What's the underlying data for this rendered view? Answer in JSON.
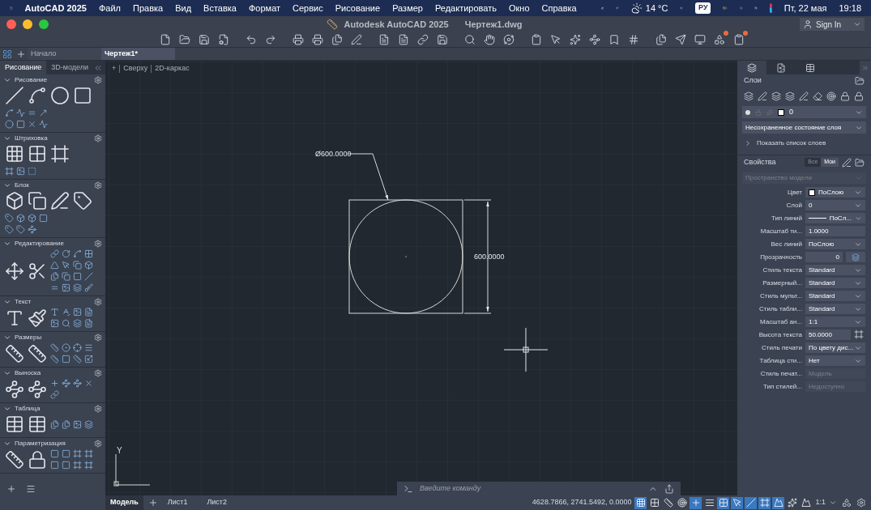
{
  "menubar": {
    "app": "AutoCAD 2025",
    "items": [
      "Файл",
      "Правка",
      "Вид",
      "Вставка",
      "Формат",
      "Сервис",
      "Рисование",
      "Размер",
      "Редактировать",
      "Окно",
      "Справка"
    ],
    "temperature": "14 °C",
    "input_language": "РУ",
    "date": "Пт, 22 мая",
    "time": "19:18"
  },
  "window": {
    "title": "Autodesk AutoCAD 2025",
    "file": "Чертеж1.dwg",
    "sign_in": "Sign In"
  },
  "doc_tabs": [
    {
      "label": "Начало",
      "selected": false
    },
    {
      "label": "Чертеж1*",
      "selected": true
    }
  ],
  "palette": {
    "tabs": [
      {
        "label": "Рисование",
        "selected": true
      },
      {
        "label": "3D-модели",
        "selected": false
      }
    ],
    "sections": [
      {
        "title": "Рисование"
      },
      {
        "title": "Штриховка"
      },
      {
        "title": "Блок"
      },
      {
        "title": "Редактирование"
      },
      {
        "title": "Текст"
      },
      {
        "title": "Размеры"
      },
      {
        "title": "Выноска"
      },
      {
        "title": "Таблица"
      },
      {
        "title": "Параметризация"
      }
    ]
  },
  "canvas": {
    "view_plus": "+",
    "view": "Сверху",
    "visual_style": "2D-каркас",
    "diameter_label": "Ø600.0000",
    "dimension_label": "600.0000",
    "ucs_label": "Y",
    "command_placeholder": "Введите команду"
  },
  "layers": {
    "title": "Слои",
    "current_layer": "0",
    "layer_state": "Несохраненное состояние слоя",
    "show_list": "Показать список слоев"
  },
  "properties": {
    "title": "Свойства",
    "filters": [
      {
        "label": "Все",
        "selected": false
      },
      {
        "label": "Мои",
        "selected": true
      }
    ],
    "space": "Пространство модели",
    "rows": [
      {
        "label": "Цвет",
        "value": "ПоСлою",
        "kind": "color"
      },
      {
        "label": "Слой",
        "value": "0",
        "kind": "dropdown"
      },
      {
        "label": "Тип линий",
        "value": "ПоСл...",
        "kind": "linetype"
      },
      {
        "label": "Масштаб ти...",
        "value": "1.0000",
        "kind": "input"
      },
      {
        "label": "Вес линий",
        "value": "ПоСлою",
        "kind": "dropdown"
      },
      {
        "label": "Прозрачность",
        "value": "0",
        "kind": "transparency"
      },
      {
        "label": "Стиль текста",
        "value": "Standard",
        "kind": "dropdown"
      },
      {
        "label": "Размерный...",
        "value": "Standard",
        "kind": "dropdown"
      },
      {
        "label": "Стиль мульт...",
        "value": "Standard",
        "kind": "dropdown"
      },
      {
        "label": "Стиль табли...",
        "value": "Standard",
        "kind": "dropdown"
      },
      {
        "label": "Масштаб ан...",
        "value": "1:1",
        "kind": "dropdown"
      },
      {
        "label": "Высота текста",
        "value": "50.0000",
        "kind": "pick"
      },
      {
        "label": "Стиль печати",
        "value": "По цвету дис...",
        "kind": "dropdown"
      },
      {
        "label": "Таблица сти...",
        "value": "Нет",
        "kind": "dropdown"
      },
      {
        "label": "Стиль печат...",
        "value": "Модель",
        "kind": "disabled"
      },
      {
        "label": "Тип стилей...",
        "value": "Недоступно",
        "kind": "disabled"
      }
    ]
  },
  "layout_tabs": [
    {
      "label": "Модель",
      "selected": true
    },
    {
      "label": "Лист1",
      "selected": false
    },
    {
      "label": "Лист2",
      "selected": false
    }
  ],
  "status_bar": {
    "coordinates": "4628.7866, 2741.5492, 0.0000",
    "annotation_scale": "1:1",
    "toggles": [
      {
        "on": true
      },
      {
        "on": false
      },
      {
        "on": false
      },
      {
        "on": false
      },
      {
        "on": true
      },
      {
        "on": false
      },
      {
        "on": true
      },
      {
        "on": true
      },
      {
        "on": true
      },
      {
        "on": true
      },
      {
        "on": true
      },
      {
        "on": false
      },
      {
        "on": false
      }
    ]
  }
}
